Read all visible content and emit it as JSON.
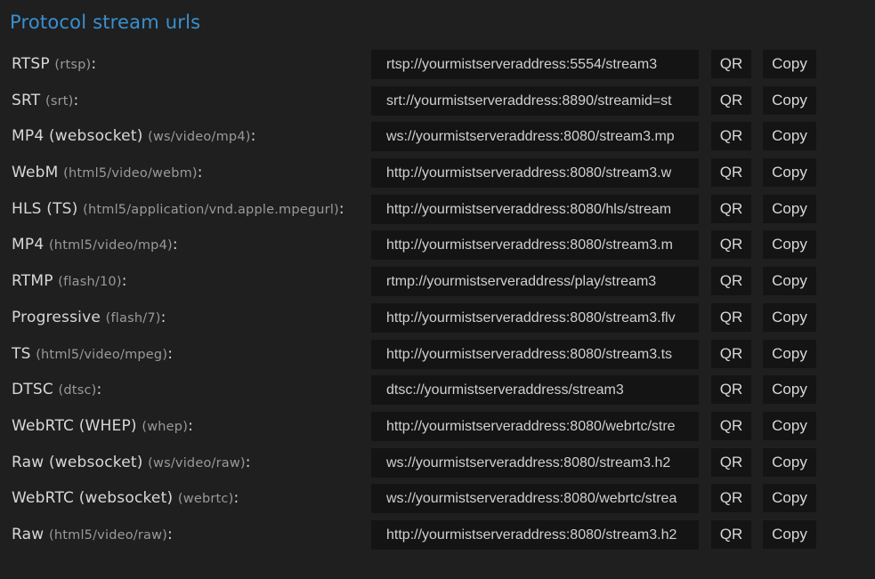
{
  "title": "Protocol stream urls",
  "buttons": {
    "qr": "QR",
    "copy": "Copy"
  },
  "protocols": [
    {
      "name": "RTSP",
      "type": "(rtsp)",
      "url": "rtsp://yourmistserveraddress:5554/stream3"
    },
    {
      "name": "SRT",
      "type": "(srt)",
      "url": "srt://yourmistserveraddress:8890/streamid=st"
    },
    {
      "name": "MP4 (websocket)",
      "type": "(ws/video/mp4)",
      "url": "ws://yourmistserveraddress:8080/stream3.mp"
    },
    {
      "name": "WebM",
      "type": "(html5/video/webm)",
      "url": "http://yourmistserveraddress:8080/stream3.w"
    },
    {
      "name": "HLS (TS)",
      "type": "(html5/application/vnd.apple.mpegurl)",
      "url": "http://yourmistserveraddress:8080/hls/stream"
    },
    {
      "name": "MP4",
      "type": "(html5/video/mp4)",
      "url": "http://yourmistserveraddress:8080/stream3.m"
    },
    {
      "name": "RTMP",
      "type": "(flash/10)",
      "url": "rtmp://yourmistserveraddress/play/stream3"
    },
    {
      "name": "Progressive",
      "type": "(flash/7)",
      "url": "http://yourmistserveraddress:8080/stream3.flv"
    },
    {
      "name": "TS",
      "type": "(html5/video/mpeg)",
      "url": "http://yourmistserveraddress:8080/stream3.ts"
    },
    {
      "name": "DTSC",
      "type": "(dtsc)",
      "url": "dtsc://yourmistserveraddress/stream3"
    },
    {
      "name": "WebRTC (WHEP)",
      "type": "(whep)",
      "url": "http://yourmistserveraddress:8080/webrtc/stre"
    },
    {
      "name": "Raw (websocket)",
      "type": "(ws/video/raw)",
      "url": "ws://yourmistserveraddress:8080/stream3.h2"
    },
    {
      "name": "WebRTC (websocket)",
      "type": "(webrtc)",
      "url": "ws://yourmistserveraddress:8080/webrtc/strea"
    },
    {
      "name": "Raw",
      "type": "(html5/video/raw)",
      "url": "http://yourmistserveraddress:8080/stream3.h2"
    }
  ]
}
